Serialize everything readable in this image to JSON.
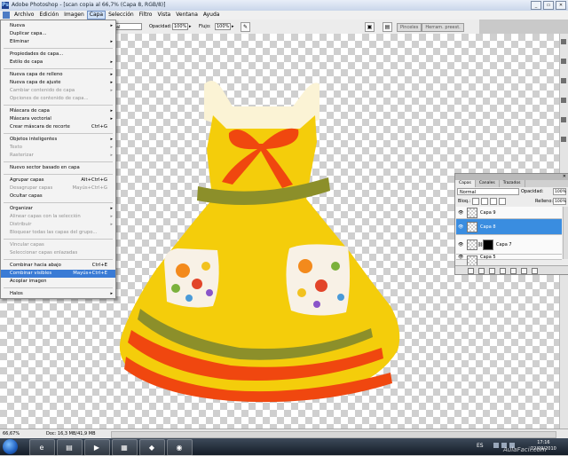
{
  "window": {
    "title": "Adobe Photoshop - [scan copia al 66,7% (Capa 8, RGB/8)]",
    "app_icon": "photoshop-icon",
    "controls": [
      "minimize-icon",
      "restore-icon",
      "close-icon"
    ]
  },
  "menubar": {
    "items": [
      "Archivo",
      "Edición",
      "Imagen",
      "Capa",
      "Selección",
      "Filtro",
      "Vista",
      "Ventana",
      "Ayuda"
    ],
    "active": "Capa"
  },
  "options_bar": {
    "mode_value": "al",
    "opacity_label": "Opacidad:",
    "opacity_value": "100%",
    "flow_label": "Flujo:",
    "flow_value": "100%",
    "panel_tabs": [
      "Pinceles",
      "Herram. preest."
    ]
  },
  "capa_menu": {
    "items": [
      {
        "label": "Nueva",
        "shortcut": "",
        "submenu": true,
        "disabled": false,
        "selected": false
      },
      {
        "label": "Duplicar capa...",
        "shortcut": "",
        "submenu": false,
        "disabled": false,
        "selected": false
      },
      {
        "label": "Eliminar",
        "shortcut": "",
        "submenu": true,
        "disabled": false,
        "selected": false
      },
      {
        "label": "Propiedades de capa...",
        "shortcut": "",
        "submenu": false,
        "disabled": false,
        "selected": false
      },
      {
        "label": "Estilo de capa",
        "shortcut": "",
        "submenu": true,
        "disabled": false,
        "selected": false
      },
      {
        "label": "Nueva capa de relleno",
        "shortcut": "",
        "submenu": true,
        "disabled": false,
        "selected": false
      },
      {
        "label": "Nueva capa de ajuste",
        "shortcut": "",
        "submenu": true,
        "disabled": false,
        "selected": false
      },
      {
        "label": "Cambiar contenido de capa",
        "shortcut": "",
        "submenu": true,
        "disabled": true,
        "selected": false
      },
      {
        "label": "Opciones de contenido de capa...",
        "shortcut": "",
        "submenu": false,
        "disabled": true,
        "selected": false
      },
      {
        "label": "Máscara de capa",
        "shortcut": "",
        "submenu": true,
        "disabled": false,
        "selected": false
      },
      {
        "label": "Máscara vectorial",
        "shortcut": "",
        "submenu": true,
        "disabled": false,
        "selected": false
      },
      {
        "label": "Crear máscara de recorte",
        "shortcut": "Ctrl+G",
        "submenu": false,
        "disabled": false,
        "selected": false
      },
      {
        "label": "Objetos inteligentes",
        "shortcut": "",
        "submenu": true,
        "disabled": false,
        "selected": false
      },
      {
        "label": "Texto",
        "shortcut": "",
        "submenu": true,
        "disabled": true,
        "selected": false
      },
      {
        "label": "Rasterizar",
        "shortcut": "",
        "submenu": true,
        "disabled": true,
        "selected": false
      },
      {
        "label": "Nuevo sector basado en capa",
        "shortcut": "",
        "submenu": false,
        "disabled": false,
        "selected": false
      },
      {
        "label": "Agrupar capas",
        "shortcut": "Alt+Ctrl+G",
        "submenu": false,
        "disabled": false,
        "selected": false
      },
      {
        "label": "Desagrupar capas",
        "shortcut": "Mayús+Ctrl+G",
        "submenu": false,
        "disabled": true,
        "selected": false
      },
      {
        "label": "Ocultar capas",
        "shortcut": "",
        "submenu": false,
        "disabled": false,
        "selected": false
      },
      {
        "label": "Organizar",
        "shortcut": "",
        "submenu": true,
        "disabled": false,
        "selected": false
      },
      {
        "label": "Alinear capas con la selección",
        "shortcut": "",
        "submenu": true,
        "disabled": true,
        "selected": false
      },
      {
        "label": "Distribuir",
        "shortcut": "",
        "submenu": true,
        "disabled": true,
        "selected": false
      },
      {
        "label": "Bloquear todas las capas del grupo...",
        "shortcut": "",
        "submenu": false,
        "disabled": true,
        "selected": false
      },
      {
        "label": "Vincular capas",
        "shortcut": "",
        "submenu": false,
        "disabled": true,
        "selected": false
      },
      {
        "label": "Seleccionar capas enlazadas",
        "shortcut": "",
        "submenu": false,
        "disabled": true,
        "selected": false
      },
      {
        "label": "Combinar hacia abajo",
        "shortcut": "Ctrl+E",
        "submenu": false,
        "disabled": false,
        "selected": false
      },
      {
        "label": "Combinar visibles",
        "shortcut": "Mayús+Ctrl+E",
        "submenu": false,
        "disabled": false,
        "selected": true
      },
      {
        "label": "Acoplar imagen",
        "shortcut": "",
        "submenu": false,
        "disabled": false,
        "selected": false
      },
      {
        "label": "Halos",
        "shortcut": "",
        "submenu": true,
        "disabled": false,
        "selected": false
      }
    ]
  },
  "layers_panel": {
    "tabs": [
      "Capas",
      "Canales",
      "Trazados"
    ],
    "blend_mode": "Normal",
    "opacity_label": "Opacidad:",
    "opacity_value": "100%",
    "lock_label": "Bloq.:",
    "fill_label": "Relleno:",
    "fill_value": "100%",
    "layers": [
      {
        "name": "Capa 9",
        "selected": false,
        "mask": false
      },
      {
        "name": "Capa 8",
        "selected": true,
        "mask": false
      },
      {
        "name": "Capa 7",
        "selected": false,
        "mask": true
      },
      {
        "name": "Capa 5",
        "selected": false,
        "mask": false
      }
    ]
  },
  "statusbar": {
    "zoom": "66,67%",
    "doc": "Doc: 16,3 MB/41,9 MB"
  },
  "taskbar": {
    "language": "ES",
    "time": "17:16",
    "date": "22/09/2010",
    "apps": [
      "internet-explorer-icon",
      "folder-icon",
      "media-player-icon",
      "photoshop-taskbar-icon",
      "app-icon",
      "chrome-icon"
    ]
  },
  "watermark": "AulaFacil.com",
  "colors": {
    "dress_yellow": "#f4cd0b",
    "dress_red": "#f0470f",
    "olive_band": "#8c8f2a",
    "menu_highlight": "#3a7bd5"
  }
}
